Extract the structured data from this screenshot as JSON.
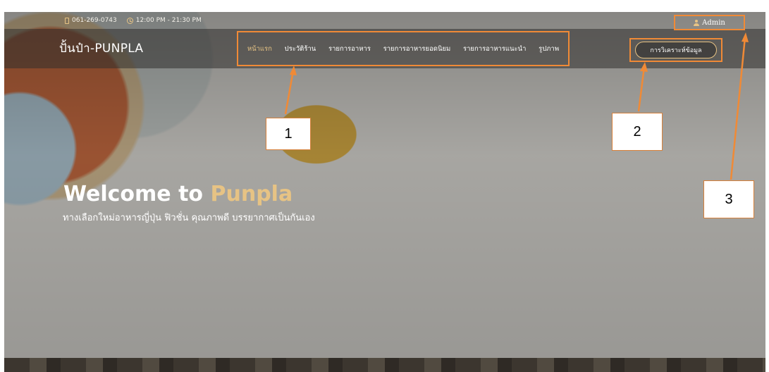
{
  "topbar": {
    "phone": "061-269-0743",
    "hours": "12:00 PM - 21:30 PM"
  },
  "brand": {
    "logo": "ปั้นป๋า-PUNPLA"
  },
  "nav": {
    "items": [
      {
        "label": "หน้าแรก",
        "active": true
      },
      {
        "label": "ประวัติร้าน"
      },
      {
        "label": "รายการอาหาร"
      },
      {
        "label": "รายการอาหารยอดนิยม"
      },
      {
        "label": "รายการอาหารแนะนำ"
      },
      {
        "label": "รูปภาพ"
      }
    ]
  },
  "actions": {
    "analysis_label": "การวิเคราะห์ข้อมูล",
    "admin_label": "Admin"
  },
  "hero": {
    "title_prefix": "Welcome to ",
    "title_accent": "Punpla",
    "subtitle": "ทางเลือกใหม่อาหารญี่ปุ่น ฟิวชั่น คุณภาพดี บรรยากาศเป็นกันเอง"
  },
  "callouts": [
    "1",
    "2",
    "3"
  ],
  "colors": {
    "annotation": "#f08a36",
    "accent_gold": "#e7c384"
  },
  "icons": [
    "phone-icon",
    "clock-icon",
    "user-icon"
  ]
}
